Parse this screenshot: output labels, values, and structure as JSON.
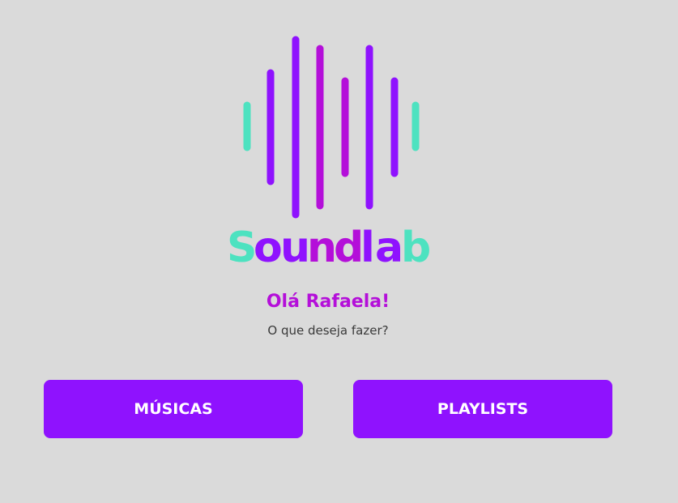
{
  "logo": {
    "wordmark": "Soundlab",
    "letters": [
      "S",
      "o",
      "u",
      "n",
      "d",
      "l",
      "a",
      "b"
    ],
    "colors": {
      "teal": "#4de2c0",
      "violet": "#8f12fe",
      "magenta": "#b40fd9"
    }
  },
  "greeting": "Olá Rafaela!",
  "subtitle": "O que deseja fazer?",
  "actions": {
    "musicas_label": "MÚSICAS",
    "playlists_label": "PLAYLISTS"
  },
  "theme": {
    "background": "#dadada",
    "button": "#8f12fe",
    "button_text": "#ffffff",
    "greeting": "#b40fd9"
  }
}
